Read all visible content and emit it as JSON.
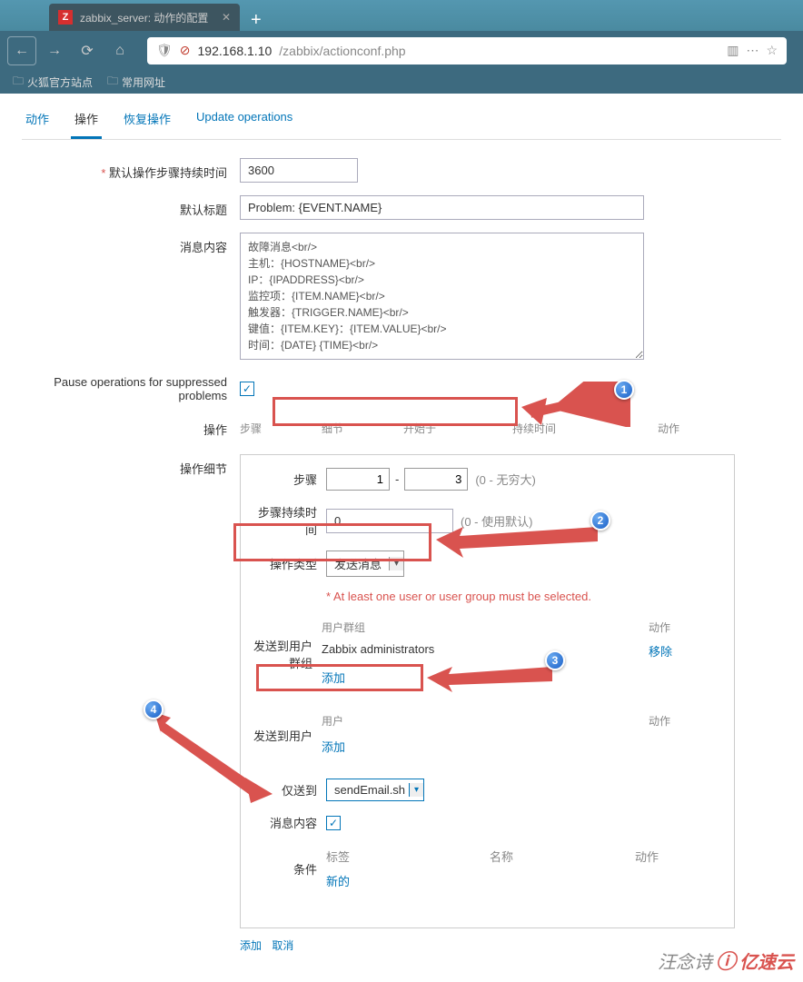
{
  "browser": {
    "tab_favicon": "Z",
    "tab_title": "zabbix_server: 动作的配置",
    "url_host": "192.168.1.10",
    "url_path": "/zabbix/actionconf.php",
    "bookmarks": [
      "火狐官方站点",
      "常用网址"
    ]
  },
  "tabs": {
    "t1": "动作",
    "t2": "操作",
    "t3": "恢复操作",
    "t4": "Update operations"
  },
  "form": {
    "default_step_duration_label": "默认操作步骤持续时间",
    "default_step_duration_value": "3600",
    "default_subject_label": "默认标题",
    "default_subject_value": "Problem: {EVENT.NAME}",
    "message_body_label": "消息内容",
    "message_body_value": "故障消息<br/>\n主机：{HOSTNAME}<br/>\nIP：{IPADDRESS}<br/>\n监控项：{ITEM.NAME}<br/>\n触发器：{TRIGGER.NAME}<br/>\n键值：{ITEM.KEY}：{ITEM.VALUE}<br/>\n时间：{DATE} {TIME}<br/>",
    "pause_label": "Pause operations for suppressed problems",
    "operations_label": "操作",
    "ops_head": {
      "c1": "步骤",
      "c2": "细节",
      "c3": "开始于",
      "c4": "持续时间",
      "c5": "动作"
    },
    "detail_label": "操作细节"
  },
  "detail": {
    "step_label": "步骤",
    "step_from": "1",
    "step_to": "3",
    "step_hint": "(0 - 无穷大)",
    "duration_label": "步骤持续时间",
    "duration_value": "0",
    "duration_hint": "(0 - 使用默认)",
    "op_type_label": "操作类型",
    "op_type_value": "发送消息",
    "warn": "At least one user or user group must be selected.",
    "send_group_label": "发送到用户群组",
    "user_group_head": "用户群组",
    "action_head": "动作",
    "group_value": "Zabbix administrators",
    "remove_link": "移除",
    "add_link": "添加",
    "send_user_label": "发送到用户",
    "user_head": "用户",
    "only_to_label": "仅送到",
    "only_to_value": "sendEmail.sh",
    "msg_content_label": "消息内容",
    "conditions_label": "条件",
    "cond_head1": "标签",
    "cond_head2": "名称",
    "cond_head3": "动作",
    "new_link": "新的",
    "bottom_add": "添加",
    "bottom_cancel": "取消"
  },
  "watermark": {
    "text": "汪念诗",
    "brand": "亿速云"
  }
}
